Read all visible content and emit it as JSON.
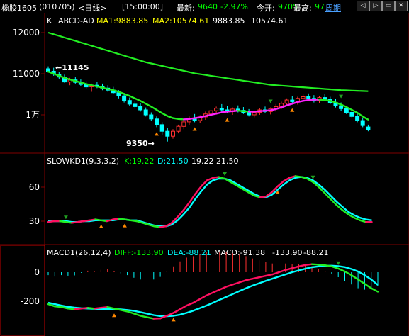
{
  "title_bar": {
    "symbol": "橡胶1605",
    "code": "(010705)",
    "period": "<日线>",
    "time": "[15:00:00]",
    "latest_label": "最新:",
    "latest_value": "9640",
    "change_pct": "-2.97%",
    "open_label": "今开:",
    "open_value": "9705",
    "high_label": "最高:",
    "high_value": "97",
    "week_link": "周期",
    "nav_buttons": [
      "prev-icon",
      "next-icon",
      "minimize-icon",
      "close-icon"
    ]
  },
  "price_panel": {
    "k_label": "K",
    "indicator_name": "ABCD-AD",
    "ma1": "MA1:9883.85",
    "ma2": "MA2:10574.61",
    "val1": "9883.85",
    "val2": "10574.61",
    "y_ticks": [
      "12000",
      "11000",
      "1万"
    ],
    "high_annotation": "←11145",
    "low_annotation": "9350→"
  },
  "kd_panel": {
    "name": "SLOWKD1(9,3,3,2)",
    "k_text": "K:19.22",
    "d_text": "D:21.50",
    "val1": "19.22",
    "val2": "21.50",
    "y_ticks": [
      "60",
      "30"
    ]
  },
  "macd_panel": {
    "name": "MACD1(26,12,4)",
    "diff_text": "DIFF:-133.90",
    "dea_text": "DEA:-88.21",
    "macd_text": "MACD:-91.38",
    "val1": "-133.90",
    "val2": "-88.21",
    "y_ticks": [
      "0",
      "-200"
    ]
  },
  "colors": {
    "background": "#000000",
    "panel_border": "#800000",
    "up": "#ff3030",
    "down": "#00ffff",
    "ma_green": "#22ee22",
    "ma_magenta": "#ff22ff",
    "yellow": "#ffff00",
    "label_blue": "#4aa0ff",
    "arrow_orange": "#ff8800",
    "arrow_green": "#20a020"
  },
  "chart_data": {
    "type": "candlestick",
    "ohlc": [
      [
        11120,
        11180,
        11030,
        11060
      ],
      [
        11060,
        11145,
        10950,
        10990
      ],
      [
        10990,
        11050,
        10880,
        10920
      ],
      [
        10920,
        10980,
        10780,
        10800
      ],
      [
        10800,
        10900,
        10720,
        10850
      ],
      [
        10850,
        10920,
        10760,
        10790
      ],
      [
        10790,
        10860,
        10700,
        10740
      ],
      [
        10740,
        10820,
        10620,
        10680
      ],
      [
        10680,
        10760,
        10560,
        10720
      ],
      [
        10720,
        10800,
        10650,
        10690
      ],
      [
        10690,
        10760,
        10600,
        10650
      ],
      [
        10650,
        10720,
        10560,
        10600
      ],
      [
        10600,
        10680,
        10500,
        10540
      ],
      [
        10540,
        10600,
        10400,
        10460
      ],
      [
        10460,
        10520,
        10300,
        10350
      ],
      [
        10350,
        10420,
        10220,
        10260
      ],
      [
        10260,
        10340,
        10150,
        10200
      ],
      [
        10200,
        10280,
        10080,
        10120
      ],
      [
        10120,
        10180,
        9960,
        10000
      ],
      [
        10000,
        10060,
        9860,
        9900
      ],
      [
        9900,
        9960,
        9700,
        9760
      ],
      [
        9760,
        9820,
        9520,
        9600
      ],
      [
        9600,
        9680,
        9350,
        9480
      ],
      [
        9480,
        9650,
        9420,
        9600
      ],
      [
        9600,
        9760,
        9550,
        9720
      ],
      [
        9720,
        9880,
        9650,
        9830
      ],
      [
        9830,
        9960,
        9760,
        9900
      ],
      [
        9900,
        10020,
        9820,
        9860
      ],
      [
        9860,
        9990,
        9800,
        9950
      ],
      [
        9950,
        10080,
        9880,
        10020
      ],
      [
        10020,
        10150,
        9960,
        10100
      ],
      [
        10100,
        10200,
        10040,
        10160
      ],
      [
        10160,
        10260,
        10060,
        10120
      ],
      [
        10120,
        10220,
        10040,
        10080
      ],
      [
        10080,
        10180,
        10000,
        10140
      ],
      [
        10140,
        10230,
        10060,
        10110
      ],
      [
        10110,
        10190,
        10020,
        10060
      ],
      [
        10060,
        10140,
        9960,
        10000
      ],
      [
        10000,
        10100,
        9940,
        10060
      ],
      [
        10060,
        10160,
        10000,
        10120
      ],
      [
        10120,
        10200,
        10040,
        10080
      ],
      [
        10080,
        10180,
        10010,
        10150
      ],
      [
        10150,
        10260,
        10080,
        10200
      ],
      [
        10200,
        10320,
        10140,
        10280
      ],
      [
        10280,
        10400,
        10220,
        10360
      ],
      [
        10360,
        10460,
        10280,
        10320
      ],
      [
        10320,
        10440,
        10250,
        10400
      ],
      [
        10400,
        10500,
        10330,
        10440
      ],
      [
        10440,
        10520,
        10360,
        10400
      ],
      [
        10400,
        10480,
        10300,
        10350
      ],
      [
        10350,
        10460,
        10280,
        10420
      ],
      [
        10420,
        10500,
        10340,
        10380
      ],
      [
        10380,
        10440,
        10260,
        10300
      ],
      [
        10300,
        10380,
        10180,
        10220
      ],
      [
        10220,
        10300,
        10100,
        10150
      ],
      [
        10150,
        10220,
        10020,
        10060
      ],
      [
        10060,
        10120,
        9920,
        9960
      ],
      [
        9960,
        10020,
        9820,
        9860
      ],
      [
        9860,
        9920,
        9700,
        9740
      ],
      [
        9705,
        9760,
        9600,
        9640
      ]
    ],
    "ma1": [
      11050,
      11000,
      10950,
      10900,
      10860,
      10820,
      10790,
      10750,
      10720,
      10690,
      10660,
      10630,
      10600,
      10560,
      10510,
      10460,
      10400,
      10340,
      10270,
      10200,
      10120,
      10040,
      9970,
      9920,
      9900,
      9890,
      9900,
      9920,
      9940,
      9970,
      10000,
      10030,
      10060,
      10080,
      10090,
      10100,
      10090,
      10080,
      10080,
      10090,
      10100,
      10110,
      10140,
      10180,
      10230,
      10270,
      10310,
      10340,
      10360,
      10370,
      10370,
      10360,
      10340,
      10300,
      10250,
      10190,
      10120,
      10050,
      9960,
      9884
    ],
    "ma2": [
      12000,
      11960,
      11920,
      11880,
      11840,
      11800,
      11760,
      11720,
      11680,
      11640,
      11600,
      11560,
      11520,
      11480,
      11440,
      11400,
      11360,
      11320,
      11280,
      11250,
      11220,
      11190,
      11160,
      11130,
      11100,
      11070,
      11040,
      11010,
      10990,
      10970,
      10950,
      10930,
      10910,
      10890,
      10870,
      10850,
      10830,
      10810,
      10790,
      10770,
      10750,
      10730,
      10720,
      10710,
      10700,
      10690,
      10680,
      10670,
      10660,
      10650,
      10640,
      10630,
      10620,
      10610,
      10600,
      10595,
      10590,
      10585,
      10580,
      10575
    ],
    "kd_k": [
      19,
      20,
      20,
      19,
      18,
      19,
      20,
      21,
      22,
      21,
      20,
      22,
      23,
      22,
      21,
      20,
      18,
      16,
      14,
      13,
      14,
      18,
      25,
      33,
      42,
      52,
      61,
      68,
      71,
      72,
      70,
      66,
      62,
      58,
      54,
      50,
      48,
      49,
      54,
      61,
      67,
      71,
      73,
      72,
      70,
      66,
      60,
      53,
      46,
      39,
      33,
      28,
      24,
      21,
      19,
      19
    ],
    "kd_d": [
      20,
      20,
      20,
      20,
      19,
      19,
      20,
      20,
      21,
      21,
      21,
      21,
      22,
      22,
      21,
      21,
      19,
      17,
      15,
      14,
      14,
      16,
      21,
      28,
      36,
      46,
      55,
      63,
      68,
      70,
      70,
      68,
      64,
      60,
      56,
      52,
      49,
      48,
      51,
      57,
      63,
      68,
      71,
      72,
      71,
      68,
      63,
      57,
      50,
      43,
      37,
      31,
      27,
      24,
      22,
      21
    ],
    "macd_diff": [
      -220,
      -235,
      -240,
      -250,
      -255,
      -250,
      -245,
      -250,
      -245,
      -240,
      -250,
      -260,
      -270,
      -285,
      -300,
      -310,
      -320,
      -318,
      -300,
      -280,
      -255,
      -230,
      -210,
      -185,
      -160,
      -140,
      -120,
      -100,
      -85,
      -70,
      -55,
      -45,
      -35,
      -25,
      -15,
      0,
      15,
      28,
      40,
      50,
      55,
      52,
      48,
      40,
      25,
      5,
      -20,
      -50,
      -80,
      -110,
      -134
    ],
    "macd_dea": [
      -210,
      -220,
      -230,
      -238,
      -244,
      -248,
      -250,
      -252,
      -253,
      -252,
      -253,
      -256,
      -260,
      -266,
      -275,
      -285,
      -295,
      -302,
      -303,
      -300,
      -292,
      -280,
      -265,
      -248,
      -230,
      -210,
      -190,
      -170,
      -150,
      -130,
      -110,
      -92,
      -76,
      -60,
      -45,
      -30,
      -15,
      0,
      12,
      24,
      34,
      40,
      44,
      45,
      42,
      35,
      22,
      5,
      -20,
      -50,
      -88
    ]
  }
}
